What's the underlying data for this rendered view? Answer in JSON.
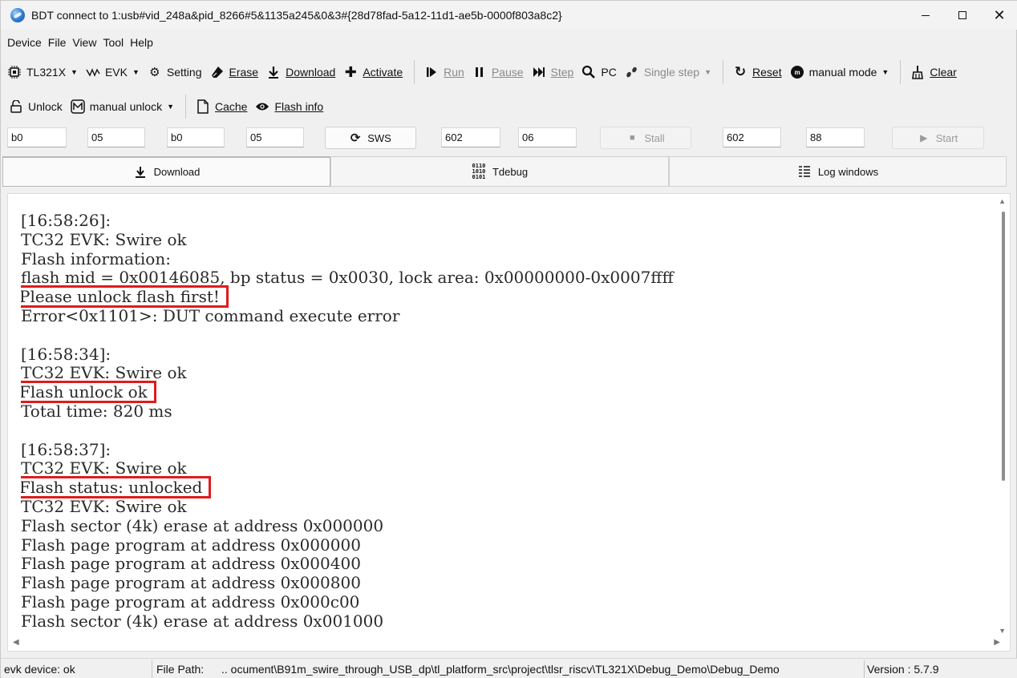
{
  "window": {
    "title": "BDT connect to 1:usb#vid_248a&pid_8266#5&1135a245&0&3#{28d78fad-5a12-11d1-ae5b-0000f803a8c2}",
    "controls": {
      "minimize": "",
      "maximize": "",
      "close": "✕"
    }
  },
  "menu": [
    "Device",
    "File",
    "View",
    "Tool",
    "Help"
  ],
  "toolbar1": {
    "chip": "TL321X",
    "evk": "EVK",
    "setting": "Setting",
    "erase": "Erase",
    "download": "Download",
    "activate": "Activate",
    "run": "Run",
    "pause": "Pause",
    "step": "Step",
    "pc": "PC",
    "single_step": "Single step",
    "reset": "Reset",
    "mode": "manual mode",
    "clear": "Clear"
  },
  "toolbar2": {
    "unlock": "Unlock",
    "manual_unlock": "manual unlock",
    "cache": "Cache",
    "flash_info": "Flash info"
  },
  "inputs": {
    "f1": "b0",
    "f2": "05",
    "f3": "b0",
    "f4": "05",
    "sws": "SWS",
    "f5": "602",
    "f6": "06",
    "stall": "Stall",
    "f7": "602",
    "f8": "88",
    "start": "Start"
  },
  "tabs": [
    {
      "label": "Download",
      "active": true
    },
    {
      "label": "Tdebug",
      "active": false
    },
    {
      "label": "Log windows",
      "active": false
    }
  ],
  "log": [
    {
      "text": "[16:58:26]:",
      "hl": false
    },
    {
      "text": "TC32 EVK: Swire ok",
      "hl": false
    },
    {
      "text": "Flash information:",
      "hl": false
    },
    {
      "text": "flash mid = 0x00146085, bp status = 0x0030, lock area: 0x00000000-0x0007ffff",
      "hl": false
    },
    {
      "text": "Please unlock flash first!",
      "hl": true
    },
    {
      "text": "Error<0x1101>: DUT command execute error",
      "hl": false
    },
    {
      "text": "",
      "hl": false
    },
    {
      "text": "[16:58:34]:",
      "hl": false
    },
    {
      "text": "TC32 EVK: Swire ok",
      "hl": false
    },
    {
      "text": "Flash unlock ok",
      "hl": true
    },
    {
      "text": "Total time: 820 ms",
      "hl": false
    },
    {
      "text": "",
      "hl": false
    },
    {
      "text": "[16:58:37]:",
      "hl": false
    },
    {
      "text": "TC32 EVK: Swire ok",
      "hl": false
    },
    {
      "text": "Flash status: unlocked",
      "hl": true
    },
    {
      "text": "TC32 EVK: Swire ok",
      "hl": false
    },
    {
      "text": "Flash sector (4k) erase at address 0x000000",
      "hl": false
    },
    {
      "text": "Flash page program at address 0x000000",
      "hl": false
    },
    {
      "text": "Flash page program at address 0x000400",
      "hl": false
    },
    {
      "text": "Flash page program at address 0x000800",
      "hl": false
    },
    {
      "text": "Flash page program at address 0x000c00",
      "hl": false
    },
    {
      "text": "Flash sector (4k) erase at address 0x001000",
      "hl": false
    }
  ],
  "status": {
    "device": "evk device: ok",
    "file_path_label": "File Path:",
    "file_path": "..  ocument\\B91m_swire_through_USB_dp\\tl_platform_src\\project\\tlsr_riscv\\TL321X\\Debug_Demo\\Debug_Demo",
    "version": "Version : 5.7.9"
  },
  "colors": {
    "highlight_box": "#e01b1b",
    "disabled_text": "#8a8a8a"
  }
}
